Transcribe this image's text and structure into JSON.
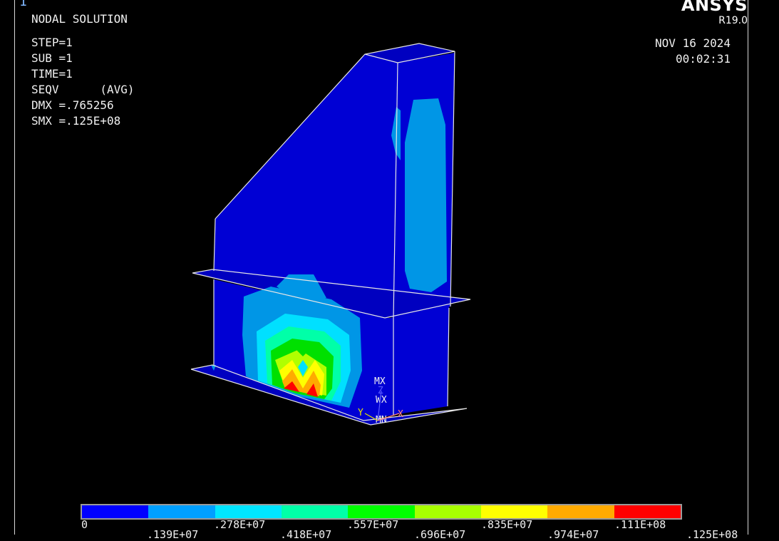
{
  "window_number": "1",
  "brand": {
    "name": "ANSYS",
    "version": "R19.0"
  },
  "info_lines": [
    "NODAL SOLUTION",
    "STEP=1",
    "SUB =1",
    "TIME=1",
    "SEQV      (AVG)",
    "DMX =.765256",
    "SMX =.125E+08"
  ],
  "date": "NOV 16 2024",
  "time": "00:02:31",
  "markers": {
    "max": "MX",
    "min": "MN",
    "axis_z": "Z",
    "axis_y": "Y",
    "axis_x": "X",
    "wx": "WX"
  },
  "legend": {
    "colors": [
      "#0000ff",
      "#00a0ff",
      "#00e6ff",
      "#00ffa8",
      "#00ff00",
      "#a8ff00",
      "#ffff00",
      "#ffaa00",
      "#ff0000"
    ],
    "upper_labels": [
      "0",
      ".278E+07",
      ".557E+07",
      ".835E+07",
      ".111E+08"
    ],
    "lower_labels": [
      ".139E+07",
      ".418E+07",
      ".696E+07",
      ".974E+07",
      ".125E+08"
    ]
  }
}
